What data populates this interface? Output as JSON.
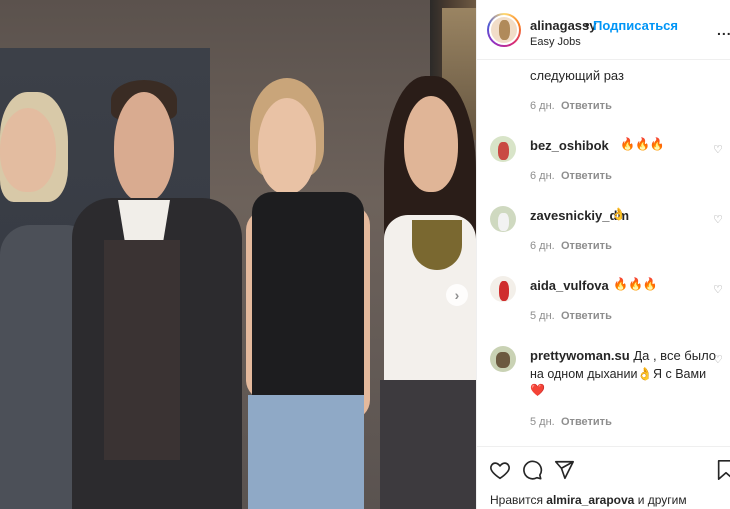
{
  "header": {
    "username": "alinagassy",
    "separator": "•",
    "follow_label": "Подписаться",
    "location": "Easy Jobs",
    "more_label": "..."
  },
  "comments": [
    {
      "username": "",
      "text": "следующий раз",
      "age": "6 дн.",
      "reply_label": "Ответить"
    },
    {
      "username": "bez_oshibok",
      "text": "🔥🔥🔥",
      "age": "6 дн.",
      "reply_label": "Ответить"
    },
    {
      "username": "zavesnickiy_dm",
      "text": "👌",
      "age": "6 дн.",
      "reply_label": "Ответить"
    },
    {
      "username": "aida_vulfova",
      "text": "🔥🔥🔥",
      "age": "5 дн.",
      "reply_label": "Ответить"
    },
    {
      "username": "prettywoman.su",
      "text_line1": "Да , все было",
      "text_line2": "на одном дыхании👌Я с Вами",
      "text_line3": "❤️",
      "age": "5 дн.",
      "reply_label": "Ответить"
    }
  ],
  "footer": {
    "likes_prefix": "Нравится",
    "likes_user": "almira_arapova",
    "likes_suffix": "и другим"
  },
  "icons": {
    "like": "heart-icon",
    "comment": "comment-icon",
    "share": "share-icon",
    "save": "bookmark-icon",
    "next": "chevron-right-icon"
  },
  "colors": {
    "accent": "#0095f6",
    "text": "#262626",
    "muted": "#8e8e8e"
  }
}
